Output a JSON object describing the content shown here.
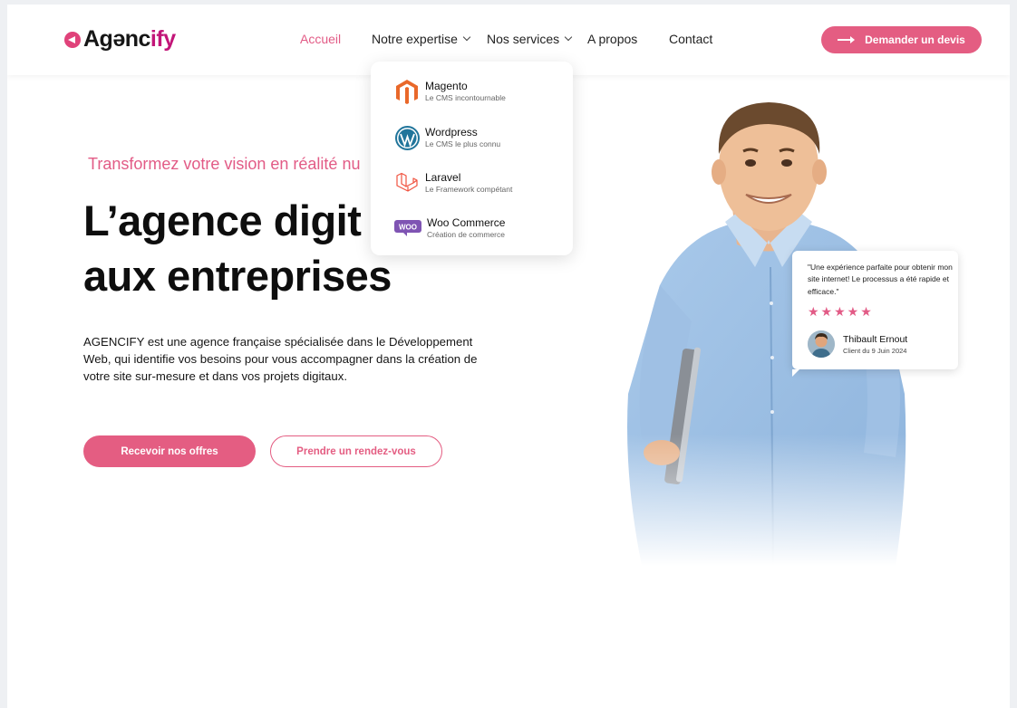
{
  "brand": {
    "logo_prefix": "Ag",
    "logo_middle": "enc",
    "logo_accent": "ify",
    "logo_letter_e": "ə"
  },
  "colors": {
    "accent": "#e45d82",
    "accent_dark": "#c21578",
    "text": "#111111"
  },
  "nav": {
    "items": [
      {
        "label": "Accueil",
        "active": true
      },
      {
        "label": "Notre expertise",
        "dropdown": true
      },
      {
        "label": "Nos services",
        "dropdown": true
      },
      {
        "label": "A propos"
      },
      {
        "label": "Contact"
      }
    ],
    "cta_label": "Demander un devis"
  },
  "expertise_menu": {
    "items": [
      {
        "title": "Magento",
        "subtitle": "Le CMS incontournable",
        "icon": "magento-icon"
      },
      {
        "title": "Wordpress",
        "subtitle": "Le CMS le plus connu",
        "icon": "wordpress-icon"
      },
      {
        "title": "Laravel",
        "subtitle": "Le Framework compétant",
        "icon": "laravel-icon"
      },
      {
        "title": "Woo Commerce",
        "subtitle": "Création de commerce",
        "icon": "woocommerce-icon"
      }
    ]
  },
  "hero": {
    "tagline": "Transformez votre vision en réalité nu",
    "heading_line1": "L’agence digit",
    "heading_line2": "aux entreprises",
    "description": "AGENCIFY est une agence française spécialisée dans le Développement Web, qui identifie vos besoins pour vous accompagner dans la création de votre site sur-mesure et dans vos projets digitaux.",
    "primary_button": "Recevoir nos offres",
    "secondary_button": "Prendre un rendez-vous"
  },
  "review": {
    "quote": "\"Une expérience parfaite pour obtenir mon site internet! Le processus a été rapide et efficace.\"",
    "rating": 4.5,
    "stars": "★★★★★",
    "name": "Thibault Ernout",
    "date": "Client du 9 Juin 2024"
  }
}
